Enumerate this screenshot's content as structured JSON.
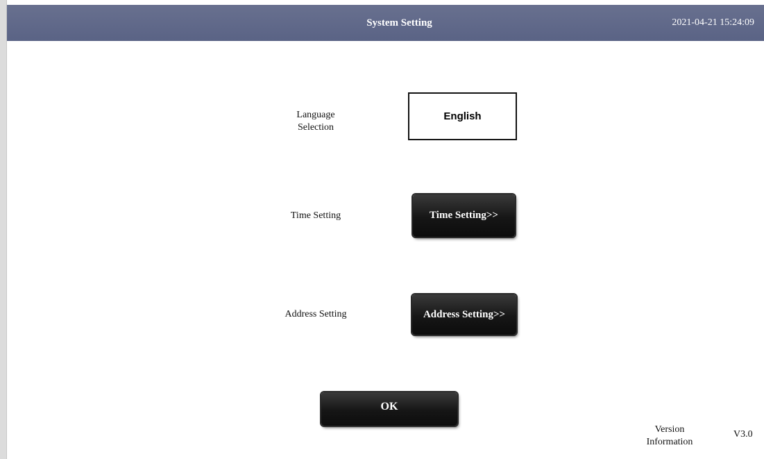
{
  "header": {
    "title": "System Setting",
    "datetime": "2021-04-21 15:24:09"
  },
  "language": {
    "label_line1": "Language",
    "label_line2": "Selection",
    "button_label": "English"
  },
  "time": {
    "label": "Time Setting",
    "button_label": "Time Setting>>"
  },
  "address": {
    "label": "Address Setting",
    "button_label": "Address Setting>>"
  },
  "ok_button": "OK",
  "version": {
    "label_line1": "Version",
    "label_line2": "Information",
    "value": "V3.0"
  },
  "colors": {
    "title_bar": "#5f6788",
    "button_dark": "#161616",
    "background": "#ffffff"
  }
}
